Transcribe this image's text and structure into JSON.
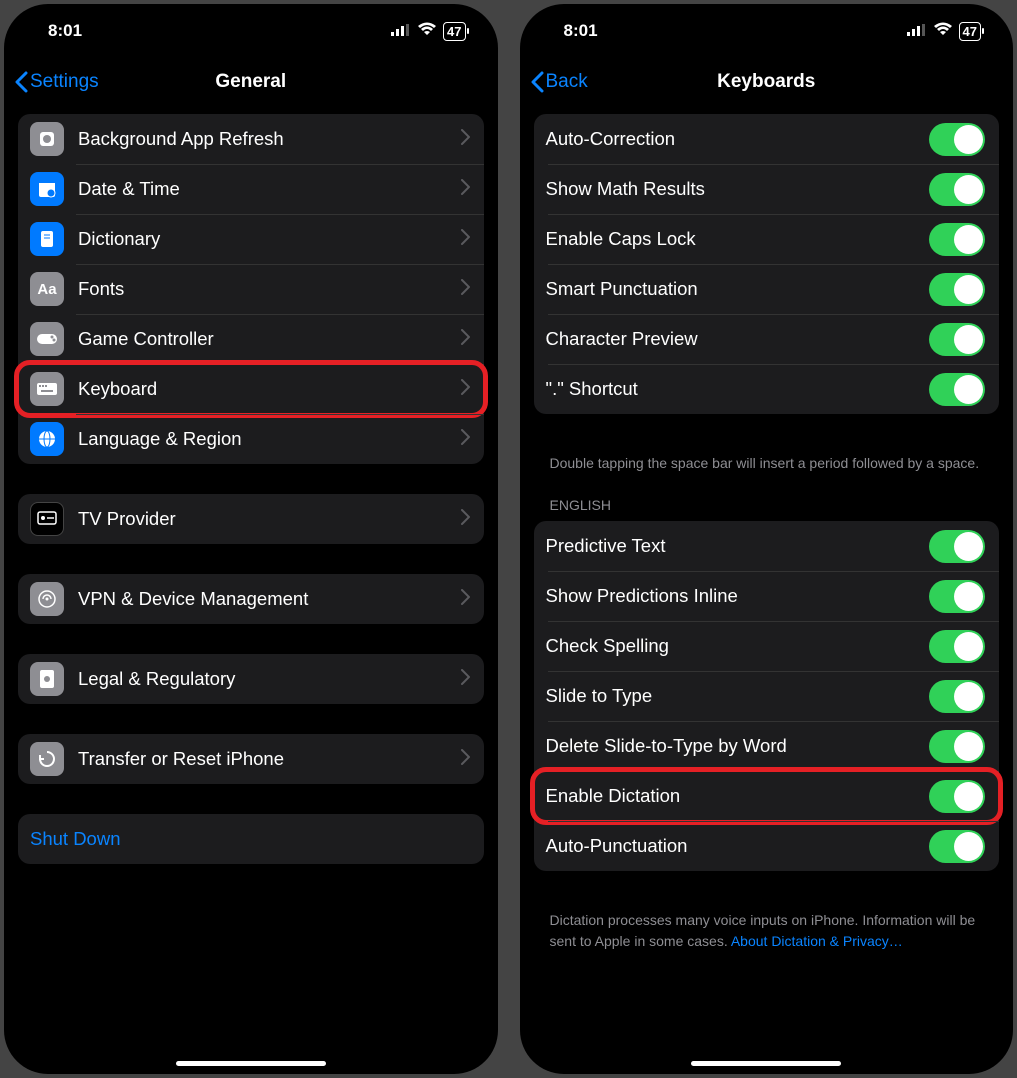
{
  "status": {
    "time": "8:01",
    "battery": "47"
  },
  "left": {
    "back_label": "Settings",
    "title": "General",
    "rows1": [
      {
        "label": "Background App Refresh",
        "icon": "refresh-app-icon",
        "cls": "ic-gray"
      },
      {
        "label": "Date & Time",
        "icon": "date-time-icon",
        "cls": "ic-blue"
      },
      {
        "label": "Dictionary",
        "icon": "dictionary-icon",
        "cls": "ic-blue"
      },
      {
        "label": "Fonts",
        "icon": "fonts-icon",
        "cls": "ic-gray"
      },
      {
        "label": "Game Controller",
        "icon": "game-controller-icon",
        "cls": "ic-gray"
      },
      {
        "label": "Keyboard",
        "icon": "keyboard-icon",
        "cls": "ic-gray",
        "hl": true
      },
      {
        "label": "Language & Region",
        "icon": "language-region-icon",
        "cls": "ic-blue"
      }
    ],
    "rows2": [
      {
        "label": "TV Provider",
        "icon": "tv-provider-icon",
        "cls": "ic-black"
      }
    ],
    "rows3": [
      {
        "label": "VPN & Device Management",
        "icon": "vpn-icon",
        "cls": "ic-gray"
      }
    ],
    "rows4": [
      {
        "label": "Legal & Regulatory",
        "icon": "legal-icon",
        "cls": "ic-gray"
      }
    ],
    "rows5": [
      {
        "label": "Transfer or Reset iPhone",
        "icon": "reset-icon",
        "cls": "ic-gray"
      }
    ],
    "shut_down": "Shut Down"
  },
  "right": {
    "back_label": "Back",
    "title": "Keyboards",
    "group1": [
      {
        "label": "Auto-Correction"
      },
      {
        "label": "Show Math Results"
      },
      {
        "label": "Enable Caps Lock"
      },
      {
        "label": "Smart Punctuation"
      },
      {
        "label": "Character Preview"
      },
      {
        "label": "\".\" Shortcut"
      }
    ],
    "footer1": "Double tapping the space bar will insert a period followed by a space.",
    "header2": "English",
    "group2": [
      {
        "label": "Predictive Text"
      },
      {
        "label": "Show Predictions Inline"
      },
      {
        "label": "Check Spelling"
      },
      {
        "label": "Slide to Type"
      },
      {
        "label": "Delete Slide-to-Type by Word"
      },
      {
        "label": "Enable Dictation",
        "hl": true
      },
      {
        "label": "Auto-Punctuation"
      }
    ],
    "footer2a": "Dictation processes many voice inputs on iPhone. Information will be sent to Apple in some cases. ",
    "footer2b": "About Dictation & Privacy…"
  }
}
